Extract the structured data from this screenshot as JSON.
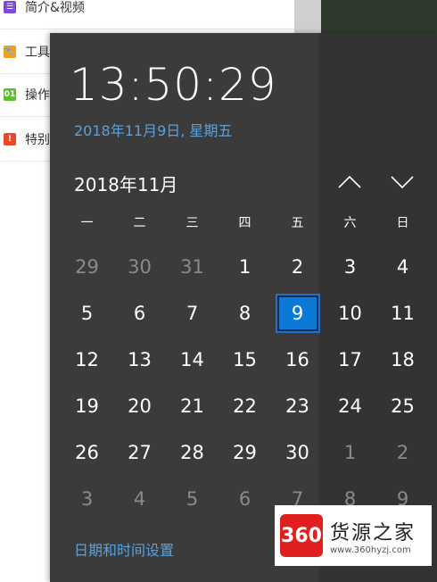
{
  "background": {
    "sidebar_items": [
      {
        "label": "简介&视频",
        "icon": "purple-square-icon",
        "color": "#7b4bd8",
        "glyph": "☰"
      },
      {
        "label": "工具",
        "icon": "wrench-icon",
        "color": "#f0a020",
        "glyph": "🔧"
      },
      {
        "label": "操作",
        "icon": "number-01-icon",
        "color": "#5cbf2a",
        "glyph": "01"
      },
      {
        "label": "特别",
        "icon": "exclamation-icon",
        "color": "#e84a2a",
        "glyph": "!"
      }
    ]
  },
  "clock": {
    "time": "13:50:29",
    "long_date": "2018年11月9日, 星期五"
  },
  "calendar": {
    "month_title": "2018年11月",
    "weekdays": [
      "一",
      "二",
      "三",
      "四",
      "五",
      "六",
      "日"
    ],
    "weeks": [
      [
        {
          "d": "29",
          "other": true
        },
        {
          "d": "30",
          "other": true
        },
        {
          "d": "31",
          "other": true
        },
        {
          "d": "1"
        },
        {
          "d": "2"
        },
        {
          "d": "3"
        },
        {
          "d": "4"
        }
      ],
      [
        {
          "d": "5"
        },
        {
          "d": "6"
        },
        {
          "d": "7"
        },
        {
          "d": "8"
        },
        {
          "d": "9",
          "today": true
        },
        {
          "d": "10"
        },
        {
          "d": "11"
        }
      ],
      [
        {
          "d": "12"
        },
        {
          "d": "13"
        },
        {
          "d": "14"
        },
        {
          "d": "15"
        },
        {
          "d": "16"
        },
        {
          "d": "17"
        },
        {
          "d": "18"
        }
      ],
      [
        {
          "d": "19"
        },
        {
          "d": "20"
        },
        {
          "d": "21"
        },
        {
          "d": "22"
        },
        {
          "d": "23"
        },
        {
          "d": "24"
        },
        {
          "d": "25"
        }
      ],
      [
        {
          "d": "26"
        },
        {
          "d": "27"
        },
        {
          "d": "28"
        },
        {
          "d": "29"
        },
        {
          "d": "30"
        },
        {
          "d": "1",
          "other": true
        },
        {
          "d": "2",
          "other": true
        }
      ],
      [
        {
          "d": "3",
          "other": true
        },
        {
          "d": "4",
          "other": true
        },
        {
          "d": "5",
          "other": true
        },
        {
          "d": "6",
          "other": true
        },
        {
          "d": "7",
          "other": true
        },
        {
          "d": "8",
          "other": true
        },
        {
          "d": "9",
          "other": true
        }
      ]
    ],
    "settings_link": "日期和时间设置"
  },
  "watermark": {
    "logo_text": "360",
    "brand": "货源之家",
    "url": "www.360hyzj.com"
  },
  "colors": {
    "flyout_bg": "#3b3b3b",
    "accent_link": "#5aa0df",
    "today_fill": "#0a7ad6"
  }
}
